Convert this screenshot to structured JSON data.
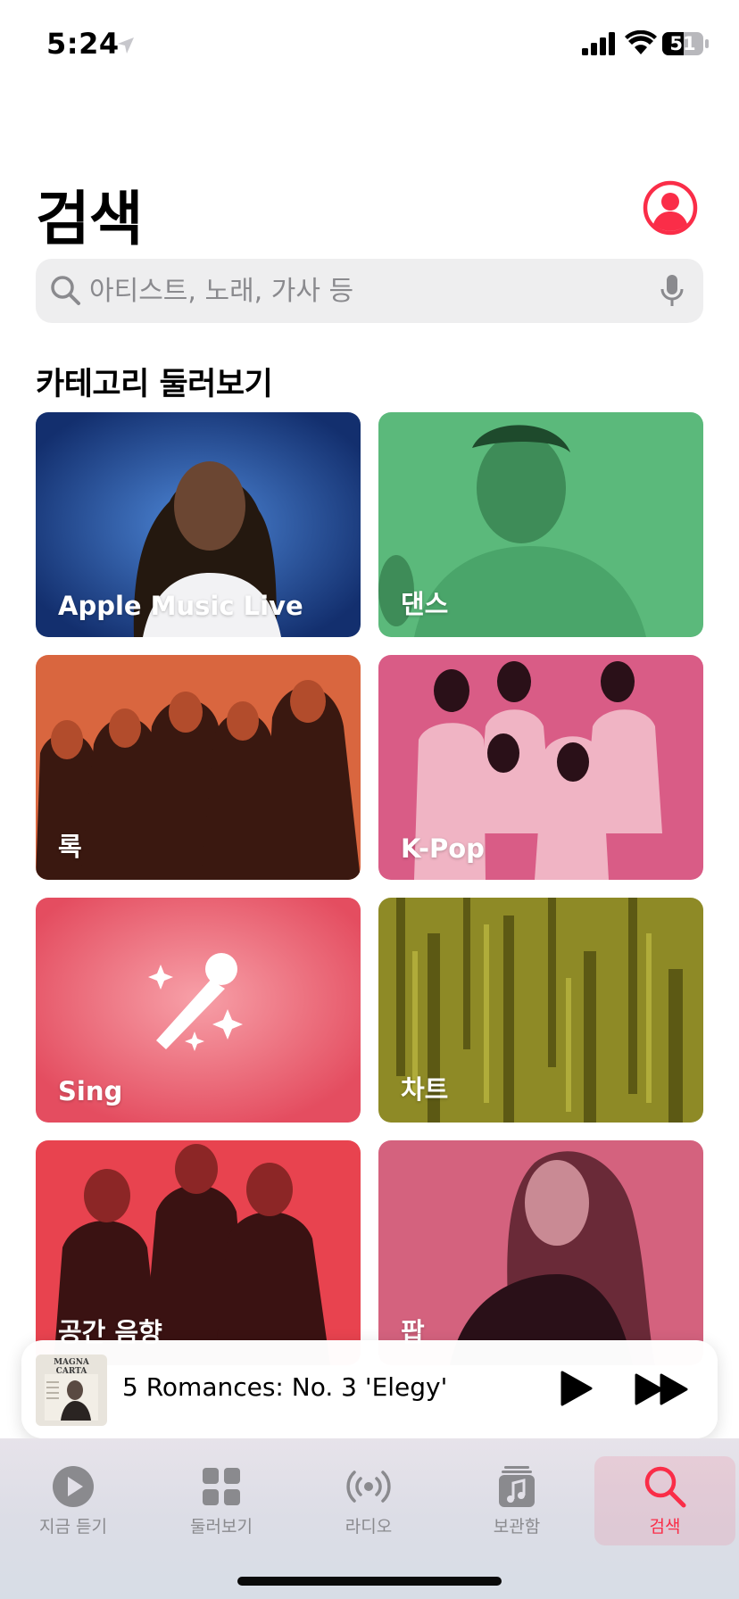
{
  "status_bar": {
    "time": "5:24",
    "battery": "51",
    "icons": [
      "location-arrow-icon",
      "cellular-signal-icon",
      "wifi-icon",
      "battery-icon"
    ]
  },
  "header": {
    "title": "검색",
    "account_icon": "person-circle-icon"
  },
  "search": {
    "placeholder": "아티스트, 노래, 가사 등",
    "value": "",
    "icons": [
      "search-icon",
      "microphone-icon"
    ]
  },
  "browse": {
    "section_title": "카테고리 둘러보기",
    "categories": [
      {
        "label": "Apple Music Live",
        "color": "#1f3f8a"
      },
      {
        "label": "댄스",
        "color": "#5bb97b"
      },
      {
        "label": "록",
        "color": "#d9663f"
      },
      {
        "label": "K-Pop",
        "color": "#d95c86"
      },
      {
        "label": "Sing",
        "color": "#ec5768"
      },
      {
        "label": "차트",
        "color": "#8e8a26"
      },
      {
        "label": "공간 음향",
        "color": "#e8434f"
      },
      {
        "label": "팝",
        "color": "#d4627e"
      }
    ]
  },
  "mini_player": {
    "album_art_text": "MAGNA CARTA",
    "track_title": "5 Romances: No. 3 'Elegy'",
    "controls": [
      "play-icon",
      "fast-forward-icon"
    ]
  },
  "tab_bar": {
    "tabs": [
      {
        "label": "지금 듣기",
        "icon": "play-circle-icon",
        "active": false
      },
      {
        "label": "둘러보기",
        "icon": "grid-icon",
        "active": false
      },
      {
        "label": "라디오",
        "icon": "radio-broadcast-icon",
        "active": false
      },
      {
        "label": "보관함",
        "icon": "music-library-icon",
        "active": false
      },
      {
        "label": "검색",
        "icon": "search-icon",
        "active": true
      }
    ]
  },
  "colors": {
    "accent": "#fa2d48",
    "search_bg": "#eeeeef",
    "inactive_tab": "#8a8a8e"
  }
}
